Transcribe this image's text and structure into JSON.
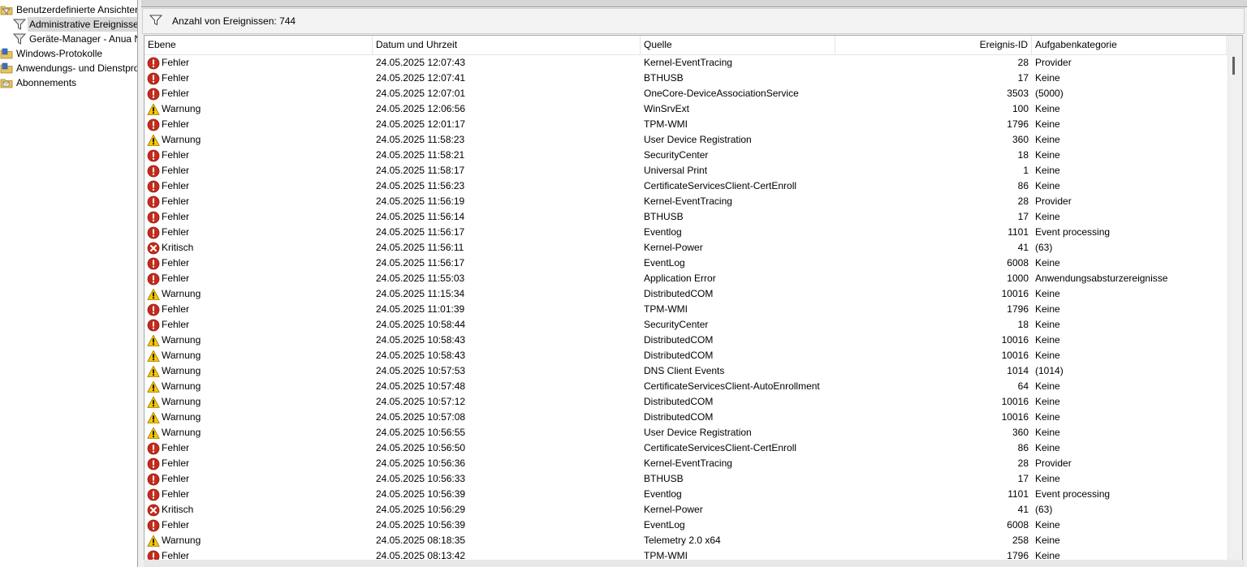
{
  "tree": {
    "items": [
      {
        "label": "Benutzerdefinierte Ansichten",
        "icon": "custom-views-folder-icon",
        "indent": 0,
        "selected": false
      },
      {
        "label": "Administrative Ereignisse",
        "icon": "filter-icon",
        "indent": 1,
        "selected": true
      },
      {
        "label": "Geräte-Manager - Anua N",
        "icon": "filter-icon",
        "indent": 1,
        "selected": false
      },
      {
        "label": "Windows-Protokolle",
        "icon": "log-folder-icon",
        "indent": 0,
        "selected": false
      },
      {
        "label": "Anwendungs- und Dienstpro",
        "icon": "log-folder-icon",
        "indent": 0,
        "selected": false
      },
      {
        "label": "Abonnements",
        "icon": "subscriptions-icon",
        "indent": 0,
        "selected": false
      }
    ]
  },
  "countbar": {
    "label": "Anzahl von Ereignissen: 744",
    "icon": "filter-icon"
  },
  "columns": {
    "level": "Ebene",
    "datetime": "Datum und Uhrzeit",
    "source": "Quelle",
    "event_id": "Ereignis-ID",
    "task_category": "Aufgabenkategorie"
  },
  "level_icons": {
    "Fehler": "error-icon",
    "Warnung": "warning-icon",
    "Kritisch": "critical-icon"
  },
  "colors": {
    "error": "#c42b1c",
    "warning": "#f7c600",
    "critical": "#c42b1c",
    "selection": "#d9d9d9"
  },
  "events": [
    {
      "level": "Fehler",
      "datetime": "24.05.2025 12:07:43",
      "source": "Kernel-EventTracing",
      "event_id": "28",
      "task_category": "Provider"
    },
    {
      "level": "Fehler",
      "datetime": "24.05.2025 12:07:41",
      "source": "BTHUSB",
      "event_id": "17",
      "task_category": "Keine"
    },
    {
      "level": "Fehler",
      "datetime": "24.05.2025 12:07:01",
      "source": "OneCore-DeviceAssociationService",
      "event_id": "3503",
      "task_category": "(5000)"
    },
    {
      "level": "Warnung",
      "datetime": "24.05.2025 12:06:56",
      "source": "WinSrvExt",
      "event_id": "100",
      "task_category": "Keine"
    },
    {
      "level": "Fehler",
      "datetime": "24.05.2025 12:01:17",
      "source": "TPM-WMI",
      "event_id": "1796",
      "task_category": "Keine"
    },
    {
      "level": "Warnung",
      "datetime": "24.05.2025 11:58:23",
      "source": "User Device Registration",
      "event_id": "360",
      "task_category": "Keine"
    },
    {
      "level": "Fehler",
      "datetime": "24.05.2025 11:58:21",
      "source": "SecurityCenter",
      "event_id": "18",
      "task_category": "Keine"
    },
    {
      "level": "Fehler",
      "datetime": "24.05.2025 11:58:17",
      "source": "Universal Print",
      "event_id": "1",
      "task_category": "Keine"
    },
    {
      "level": "Fehler",
      "datetime": "24.05.2025 11:56:23",
      "source": "CertificateServicesClient-CertEnroll",
      "event_id": "86",
      "task_category": "Keine"
    },
    {
      "level": "Fehler",
      "datetime": "24.05.2025 11:56:19",
      "source": "Kernel-EventTracing",
      "event_id": "28",
      "task_category": "Provider"
    },
    {
      "level": "Fehler",
      "datetime": "24.05.2025 11:56:14",
      "source": "BTHUSB",
      "event_id": "17",
      "task_category": "Keine"
    },
    {
      "level": "Fehler",
      "datetime": "24.05.2025 11:56:17",
      "source": "Eventlog",
      "event_id": "1101",
      "task_category": "Event processing"
    },
    {
      "level": "Kritisch",
      "datetime": "24.05.2025 11:56:11",
      "source": "Kernel-Power",
      "event_id": "41",
      "task_category": "(63)"
    },
    {
      "level": "Fehler",
      "datetime": "24.05.2025 11:56:17",
      "source": "EventLog",
      "event_id": "6008",
      "task_category": "Keine"
    },
    {
      "level": "Fehler",
      "datetime": "24.05.2025 11:55:03",
      "source": "Application Error",
      "event_id": "1000",
      "task_category": "Anwendungsabsturzereignisse"
    },
    {
      "level": "Warnung",
      "datetime": "24.05.2025 11:15:34",
      "source": "DistributedCOM",
      "event_id": "10016",
      "task_category": "Keine"
    },
    {
      "level": "Fehler",
      "datetime": "24.05.2025 11:01:39",
      "source": "TPM-WMI",
      "event_id": "1796",
      "task_category": "Keine"
    },
    {
      "level": "Fehler",
      "datetime": "24.05.2025 10:58:44",
      "source": "SecurityCenter",
      "event_id": "18",
      "task_category": "Keine"
    },
    {
      "level": "Warnung",
      "datetime": "24.05.2025 10:58:43",
      "source": "DistributedCOM",
      "event_id": "10016",
      "task_category": "Keine"
    },
    {
      "level": "Warnung",
      "datetime": "24.05.2025 10:58:43",
      "source": "DistributedCOM",
      "event_id": "10016",
      "task_category": "Keine"
    },
    {
      "level": "Warnung",
      "datetime": "24.05.2025 10:57:53",
      "source": "DNS Client Events",
      "event_id": "1014",
      "task_category": "(1014)"
    },
    {
      "level": "Warnung",
      "datetime": "24.05.2025 10:57:48",
      "source": "CertificateServicesClient-AutoEnrollment",
      "event_id": "64",
      "task_category": "Keine"
    },
    {
      "level": "Warnung",
      "datetime": "24.05.2025 10:57:12",
      "source": "DistributedCOM",
      "event_id": "10016",
      "task_category": "Keine"
    },
    {
      "level": "Warnung",
      "datetime": "24.05.2025 10:57:08",
      "source": "DistributedCOM",
      "event_id": "10016",
      "task_category": "Keine"
    },
    {
      "level": "Warnung",
      "datetime": "24.05.2025 10:56:55",
      "source": "User Device Registration",
      "event_id": "360",
      "task_category": "Keine"
    },
    {
      "level": "Fehler",
      "datetime": "24.05.2025 10:56:50",
      "source": "CertificateServicesClient-CertEnroll",
      "event_id": "86",
      "task_category": "Keine"
    },
    {
      "level": "Fehler",
      "datetime": "24.05.2025 10:56:36",
      "source": "Kernel-EventTracing",
      "event_id": "28",
      "task_category": "Provider"
    },
    {
      "level": "Fehler",
      "datetime": "24.05.2025 10:56:33",
      "source": "BTHUSB",
      "event_id": "17",
      "task_category": "Keine"
    },
    {
      "level": "Fehler",
      "datetime": "24.05.2025 10:56:39",
      "source": "Eventlog",
      "event_id": "1101",
      "task_category": "Event processing"
    },
    {
      "level": "Kritisch",
      "datetime": "24.05.2025 10:56:29",
      "source": "Kernel-Power",
      "event_id": "41",
      "task_category": "(63)"
    },
    {
      "level": "Fehler",
      "datetime": "24.05.2025 10:56:39",
      "source": "EventLog",
      "event_id": "6008",
      "task_category": "Keine"
    },
    {
      "level": "Warnung",
      "datetime": "24.05.2025 08:18:35",
      "source": "Telemetry 2.0 x64",
      "event_id": "258",
      "task_category": "Keine"
    },
    {
      "level": "Fehler",
      "datetime": "24.05.2025 08:13:42",
      "source": "TPM-WMI",
      "event_id": "1796",
      "task_category": "Keine"
    }
  ]
}
